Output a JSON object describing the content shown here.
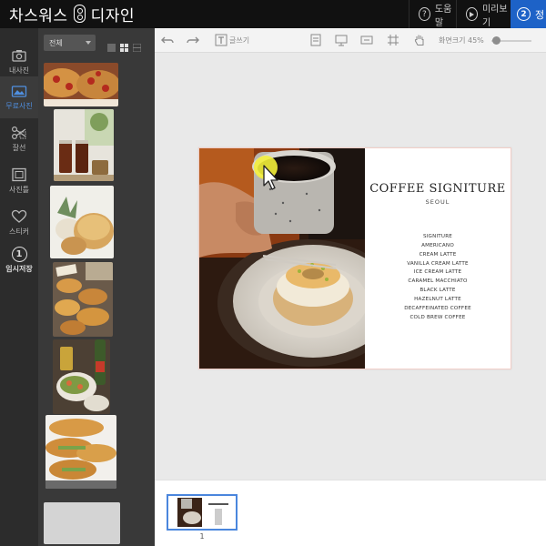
{
  "app": {
    "logo_left": "차스워스",
    "logo_right": "디자인",
    "help_label": "도움말",
    "help_glyph": "?",
    "preview_label": "미리보기",
    "next_step_number": "2",
    "next_step_label": "정"
  },
  "rail": {
    "items": [
      {
        "label": "내사진",
        "icon": "camera-icon"
      },
      {
        "label": "무료사진",
        "icon": "free-photo-icon",
        "active": true
      },
      {
        "label": "잘선",
        "icon": "scissors-icon"
      },
      {
        "label": "사진틀",
        "icon": "frame-icon"
      },
      {
        "label": "스티커",
        "icon": "heart-icon"
      },
      {
        "label": "임시저장",
        "icon": "save-number-icon",
        "glyph": "1"
      }
    ]
  },
  "panel": {
    "filter_value": "전체"
  },
  "toolbar": {
    "text_tool_label": "글쓰기",
    "zoom_label": "화면크기 45%",
    "zoom_level": 0.05
  },
  "menu": {
    "title": "COFFEE SIGNITURE",
    "subtitle": "SEOUL",
    "items": [
      "SIGNITURE",
      "AMERICANO",
      "CREAM LATTE",
      "VANILLA CREAM LATTE",
      "ICE CREAM LATTE",
      "CARAMEL MACCHIATO",
      "BLACK LATTE",
      "HAZELNUT LATTE",
      "DECAFFEINATED COFFEE",
      "COLD BREW COFFEE"
    ]
  },
  "pages": {
    "current_number": "1"
  },
  "colors": {
    "accent": "#1d62c7",
    "rail_active": "#4f8fe0",
    "page_border": "#f2cfc8"
  }
}
